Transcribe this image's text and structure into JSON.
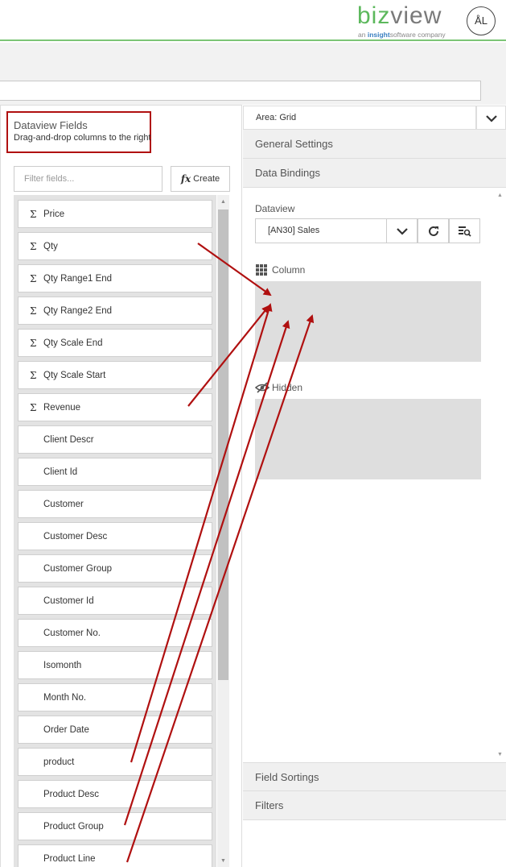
{
  "header": {
    "logo_biz": "biz",
    "logo_view": "view",
    "logo_prefix": "an",
    "logo_brand": "insight",
    "logo_suffix": "software company",
    "avatar_initials": "ÅL",
    "accent_color": "#7cc576"
  },
  "left_panel": {
    "title": "Dataview Fields",
    "subtitle": "Drag-and-drop columns to the right",
    "filter_placeholder": "Filter fields...",
    "create_label": "Create",
    "create_icon": "fx-icon",
    "fields": [
      {
        "label": "Price",
        "sigma": "Σ"
      },
      {
        "label": "Qty",
        "sigma": "Σ"
      },
      {
        "label": "Qty Range1 End",
        "sigma": "Σ"
      },
      {
        "label": "Qty Range2 End",
        "sigma": "Σ"
      },
      {
        "label": "Qty Scale End",
        "sigma": "Σ"
      },
      {
        "label": "Qty Scale Start",
        "sigma": "Σ"
      },
      {
        "label": "Revenue",
        "sigma": "Σ"
      },
      {
        "label": "Client Descr",
        "sigma": ""
      },
      {
        "label": "Client Id",
        "sigma": ""
      },
      {
        "label": "Customer",
        "sigma": ""
      },
      {
        "label": "Customer Desc",
        "sigma": ""
      },
      {
        "label": "Customer Group",
        "sigma": ""
      },
      {
        "label": "Customer Id",
        "sigma": ""
      },
      {
        "label": "Customer No.",
        "sigma": ""
      },
      {
        "label": "Isomonth",
        "sigma": ""
      },
      {
        "label": "Month No.",
        "sigma": ""
      },
      {
        "label": "Order Date",
        "sigma": ""
      },
      {
        "label": "product",
        "sigma": ""
      },
      {
        "label": "Product Desc",
        "sigma": ""
      },
      {
        "label": "Product Group",
        "sigma": ""
      },
      {
        "label": "Product Line",
        "sigma": ""
      }
    ]
  },
  "right_panel": {
    "area_label": "Area: Grid",
    "sections": {
      "general": "General Settings",
      "bindings": "Data Bindings",
      "sortings": "Field Sortings",
      "filters": "Filters"
    },
    "dataview_label": "Dataview",
    "dataview_value": "[AN30] Sales",
    "column_label": "Column",
    "hidden_label": "Hidden"
  },
  "annotation_color": "#b01010"
}
